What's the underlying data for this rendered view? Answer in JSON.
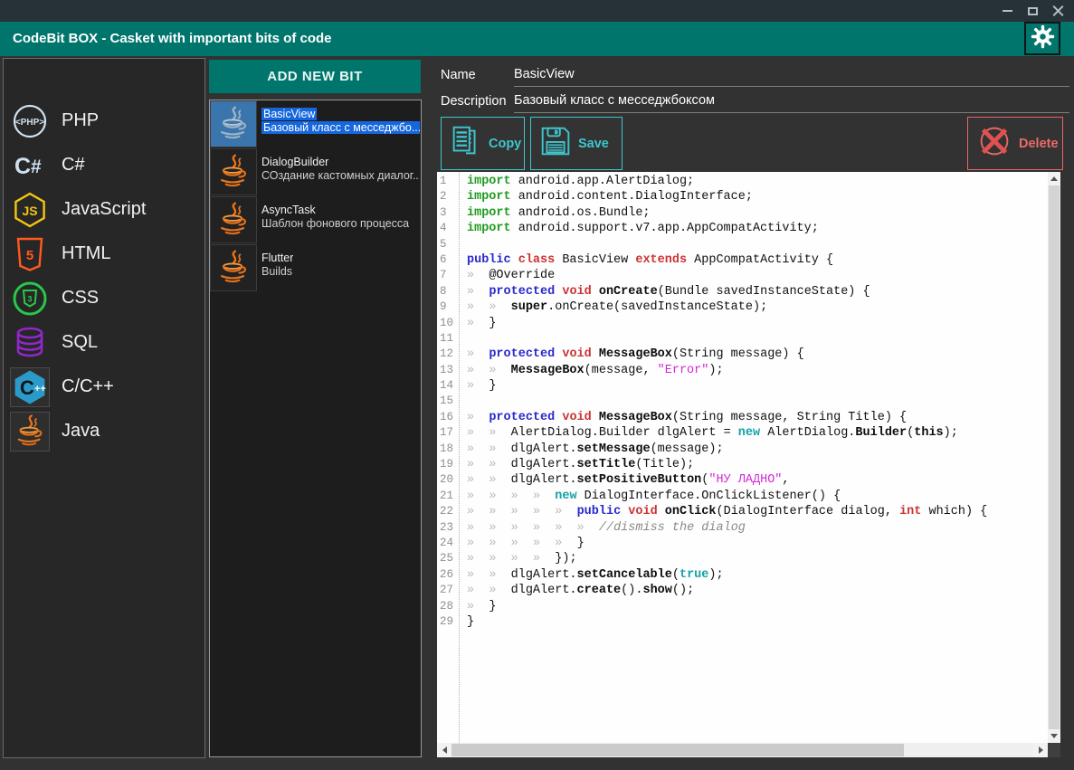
{
  "window": {
    "title": "CodeBit BOX - Casket with important bits of code",
    "controls": [
      "minimize",
      "maximize",
      "close"
    ]
  },
  "sidebar": {
    "items": [
      {
        "id": "php",
        "label": "PHP",
        "icon": "php-icon"
      },
      {
        "id": "csharp",
        "label": "C#",
        "icon": "csharp-icon"
      },
      {
        "id": "javascript",
        "label": "JavaScript",
        "icon": "javascript-icon"
      },
      {
        "id": "html",
        "label": "HTML",
        "icon": "html5-icon"
      },
      {
        "id": "css",
        "label": "CSS",
        "icon": "css3-icon"
      },
      {
        "id": "sql",
        "label": "SQL",
        "icon": "sql-database-icon"
      },
      {
        "id": "cpp",
        "label": "C/C++",
        "icon": "cpp-icon",
        "tile": true
      },
      {
        "id": "java",
        "label": "Java",
        "icon": "java-cup-icon",
        "tile": true
      }
    ]
  },
  "bits": {
    "add_button": "ADD NEW BIT",
    "items": [
      {
        "title": "BasicView",
        "desc": "Базовый класс с месседжбо...",
        "selected": true
      },
      {
        "title": "DialogBuilder",
        "desc": "СОздание кастомных диалог...",
        "selected": false
      },
      {
        "title": "AsyncTask",
        "desc": "Шаблон фонового процесса",
        "selected": false
      },
      {
        "title": "Flutter",
        "desc": "Builds",
        "selected": false
      }
    ]
  },
  "details": {
    "name_label": "Name",
    "name_value": "BasicView",
    "description_label": "Description",
    "description_value": "Базовый класс с месседжбоксом"
  },
  "toolbar": {
    "copy_label": "Copy",
    "save_label": "Save",
    "delete_label": "Delete"
  },
  "colors": {
    "titlebar": "#263238",
    "accent_teal": "#00756c",
    "button_teal": "#3ec6ce",
    "button_red": "#e96565",
    "selection_blue": "#1667dd"
  },
  "code": {
    "line_count": 29,
    "lines": [
      [
        [
          "import",
          "g"
        ],
        [
          " android.app.AlertDialog;",
          "p"
        ]
      ],
      [
        [
          "import",
          "g"
        ],
        [
          " android.content.DialogInterface;",
          "p"
        ]
      ],
      [
        [
          "import",
          "g"
        ],
        [
          " android.os.Bundle;",
          "p"
        ]
      ],
      [
        [
          "import",
          "g"
        ],
        [
          " android.support.v7.app.AppCompatActivity;",
          "p"
        ]
      ],
      [],
      [
        [
          "public",
          "b"
        ],
        [
          " ",
          "p"
        ],
        [
          "class",
          "r"
        ],
        [
          " BasicView ",
          "p"
        ],
        [
          "extends",
          "r"
        ],
        [
          " AppCompatActivity {",
          "p"
        ]
      ],
      [
        [
          "»  ",
          "i"
        ],
        [
          "@Override",
          "p"
        ]
      ],
      [
        [
          "»  ",
          "i"
        ],
        [
          "protected",
          "b"
        ],
        [
          " ",
          "p"
        ],
        [
          "void",
          "r"
        ],
        [
          " ",
          "p"
        ],
        [
          "onCreate",
          "d"
        ],
        [
          "(Bundle savedInstanceState) {",
          "p"
        ]
      ],
      [
        [
          "»  ",
          "i"
        ],
        [
          "»  ",
          "i"
        ],
        [
          "super",
          "d"
        ],
        [
          ".onCreate(savedInstanceState);",
          "p"
        ]
      ],
      [
        [
          "»  ",
          "i"
        ],
        [
          "}",
          "p"
        ]
      ],
      [],
      [
        [
          "»  ",
          "i"
        ],
        [
          "protected",
          "b"
        ],
        [
          " ",
          "p"
        ],
        [
          "void",
          "r"
        ],
        [
          " ",
          "p"
        ],
        [
          "MessageBox",
          "d"
        ],
        [
          "(String message) {",
          "p"
        ]
      ],
      [
        [
          "»  ",
          "i"
        ],
        [
          "»  ",
          "i"
        ],
        [
          "MessageBox",
          "d"
        ],
        [
          "(message, ",
          "p"
        ],
        [
          "\"Error\"",
          "m"
        ],
        [
          ");",
          "p"
        ]
      ],
      [
        [
          "»  ",
          "i"
        ],
        [
          "}",
          "p"
        ]
      ],
      [],
      [
        [
          "»  ",
          "i"
        ],
        [
          "protected",
          "b"
        ],
        [
          " ",
          "p"
        ],
        [
          "void",
          "r"
        ],
        [
          " ",
          "p"
        ],
        [
          "MessageBox",
          "d"
        ],
        [
          "(String message, String Title) {",
          "p"
        ]
      ],
      [
        [
          "»  ",
          "i"
        ],
        [
          "»  ",
          "i"
        ],
        [
          "AlertDialog.Builder dlgAlert = ",
          "p"
        ],
        [
          "new",
          "t"
        ],
        [
          " AlertDialog.",
          "p"
        ],
        [
          "Builder",
          "d"
        ],
        [
          "(",
          "p"
        ],
        [
          "this",
          "d"
        ],
        [
          ");",
          "p"
        ]
      ],
      [
        [
          "»  ",
          "i"
        ],
        [
          "»  ",
          "i"
        ],
        [
          "dlgAlert.",
          "p"
        ],
        [
          "setMessage",
          "d"
        ],
        [
          "(message);",
          "p"
        ]
      ],
      [
        [
          "»  ",
          "i"
        ],
        [
          "»  ",
          "i"
        ],
        [
          "dlgAlert.",
          "p"
        ],
        [
          "setTitle",
          "d"
        ],
        [
          "(Title);",
          "p"
        ]
      ],
      [
        [
          "»  ",
          "i"
        ],
        [
          "»  ",
          "i"
        ],
        [
          "dlgAlert.",
          "p"
        ],
        [
          "setPositiveButton",
          "d"
        ],
        [
          "(",
          "p"
        ],
        [
          "\"НУ ЛАДНО\"",
          "m"
        ],
        [
          ",",
          "p"
        ]
      ],
      [
        [
          "»  ",
          "i"
        ],
        [
          "»  ",
          "i"
        ],
        [
          "»  ",
          "i"
        ],
        [
          "»  ",
          "i"
        ],
        [
          "new",
          "t"
        ],
        [
          " DialogInterface.OnClickListener() {",
          "p"
        ]
      ],
      [
        [
          "»  ",
          "i"
        ],
        [
          "»  ",
          "i"
        ],
        [
          "»  ",
          "i"
        ],
        [
          "»  ",
          "i"
        ],
        [
          "»  ",
          "i"
        ],
        [
          "public",
          "b"
        ],
        [
          " ",
          "p"
        ],
        [
          "void",
          "r"
        ],
        [
          " ",
          "p"
        ],
        [
          "onClick",
          "d"
        ],
        [
          "(DialogInterface dialog, ",
          "p"
        ],
        [
          "int",
          "r"
        ],
        [
          " which) {",
          "p"
        ]
      ],
      [
        [
          "»  ",
          "i"
        ],
        [
          "»  ",
          "i"
        ],
        [
          "»  ",
          "i"
        ],
        [
          "»  ",
          "i"
        ],
        [
          "»  ",
          "i"
        ],
        [
          "»  ",
          "i"
        ],
        [
          "//dismiss the dialog",
          "c"
        ]
      ],
      [
        [
          "»  ",
          "i"
        ],
        [
          "»  ",
          "i"
        ],
        [
          "»  ",
          "i"
        ],
        [
          "»  ",
          "i"
        ],
        [
          "»  ",
          "i"
        ],
        [
          "}",
          "p"
        ]
      ],
      [
        [
          "»  ",
          "i"
        ],
        [
          "»  ",
          "i"
        ],
        [
          "»  ",
          "i"
        ],
        [
          "»  ",
          "i"
        ],
        [
          "});",
          "p"
        ]
      ],
      [
        [
          "»  ",
          "i"
        ],
        [
          "»  ",
          "i"
        ],
        [
          "dlgAlert.",
          "p"
        ],
        [
          "setCancelable",
          "d"
        ],
        [
          "(",
          "p"
        ],
        [
          "true",
          "t"
        ],
        [
          ");",
          "p"
        ]
      ],
      [
        [
          "»  ",
          "i"
        ],
        [
          "»  ",
          "i"
        ],
        [
          "dlgAlert.",
          "p"
        ],
        [
          "create",
          "d"
        ],
        [
          "().",
          "p"
        ],
        [
          "show",
          "d"
        ],
        [
          "();",
          "p"
        ]
      ],
      [
        [
          "»  ",
          "i"
        ],
        [
          "}",
          "p"
        ]
      ],
      [
        [
          "}",
          "p"
        ]
      ]
    ]
  }
}
